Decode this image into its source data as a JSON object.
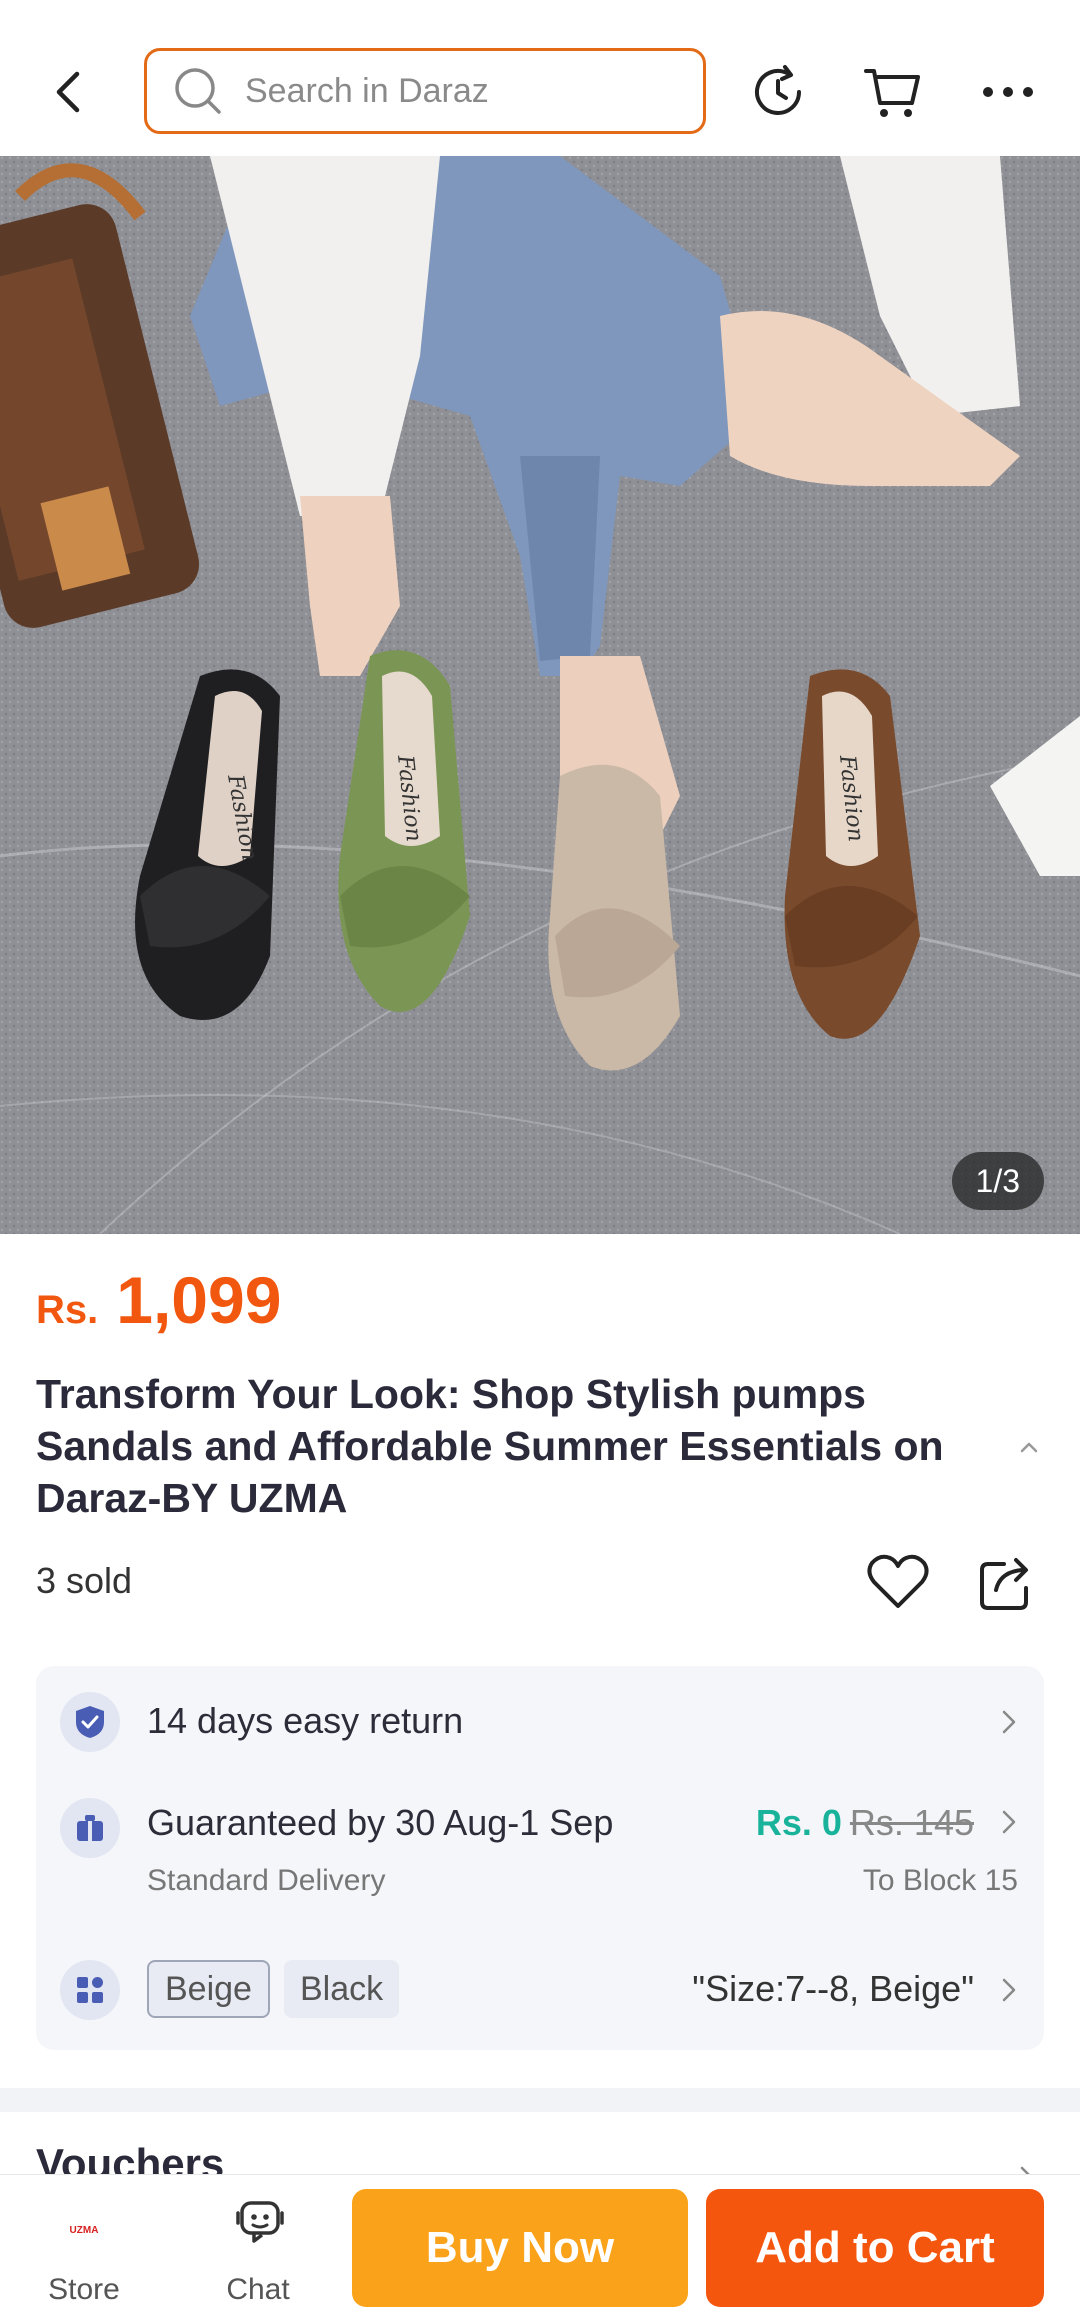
{
  "header": {
    "search_placeholder": "Search in Daraz"
  },
  "gallery": {
    "page_indicator": "1/3",
    "image_label": "Fashion"
  },
  "product": {
    "currency": "Rs.",
    "price": "1,099",
    "title": "Transform Your Look: Shop Stylish pumps Sandals and Affordable Summer Essentials on Daraz-BY UZMA",
    "sold": "3 sold"
  },
  "info": {
    "return": {
      "label": "14 days easy return"
    },
    "delivery": {
      "label": "Guaranteed by 30 Aug-1 Sep",
      "sub": "Standard Delivery",
      "fee": "Rs. 0",
      "old_fee": "Rs. 145",
      "location": "To Block 15"
    },
    "variants": {
      "options": [
        "Beige",
        "Black"
      ],
      "selected_summary": "\"Size:7--8, Beige\""
    }
  },
  "sections": {
    "vouchers": "Vouchers"
  },
  "bottom_bar": {
    "store_label": "Store",
    "store_logo": "UZMA",
    "chat_label": "Chat",
    "buy_now": "Buy Now",
    "add_to_cart": "Add to Cart"
  },
  "colors": {
    "accent_orange": "#f5560e",
    "buy_now_orange": "#faa21a",
    "free_shipping_teal": "#18b39a",
    "search_border": "#e36a16"
  }
}
